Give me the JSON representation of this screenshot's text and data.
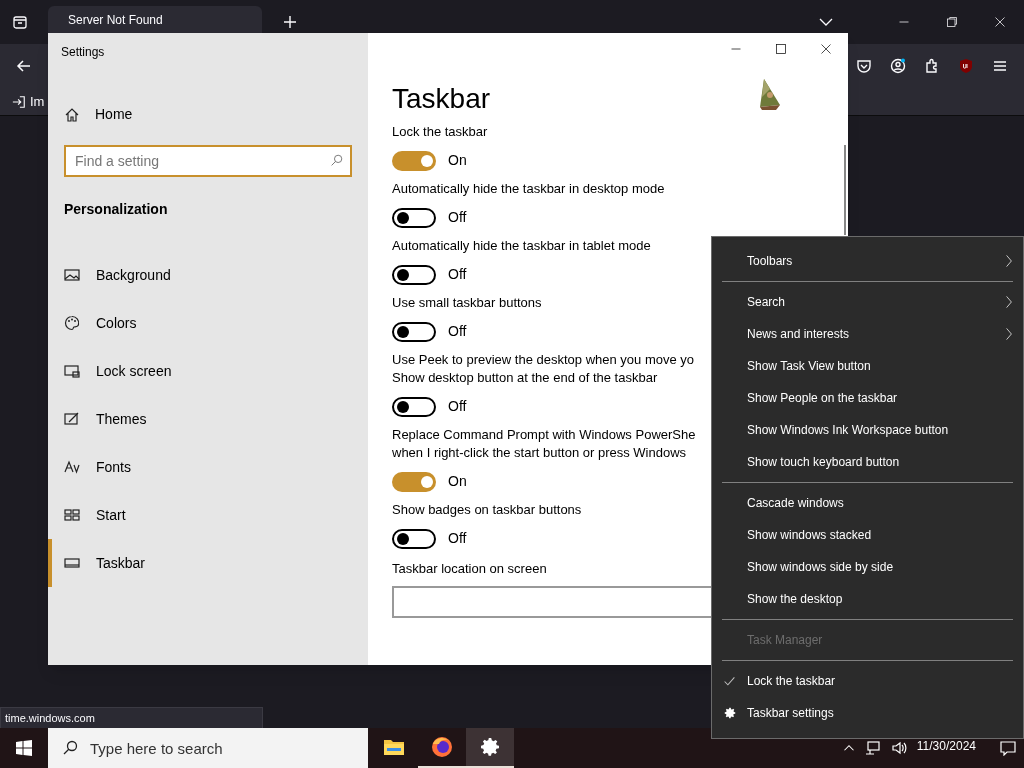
{
  "browser": {
    "tab_title": "Server Not Found",
    "bookmark": "Im",
    "status_url": "time.windows.com"
  },
  "settings": {
    "title": "Settings",
    "home": "Home",
    "search_placeholder": "Find a setting",
    "section": "Personalization",
    "nav": [
      {
        "label": "Background",
        "kind": "background",
        "selected": false
      },
      {
        "label": "Colors",
        "kind": "colors",
        "selected": false
      },
      {
        "label": "Lock screen",
        "kind": "lock",
        "selected": false
      },
      {
        "label": "Themes",
        "kind": "themes",
        "selected": false
      },
      {
        "label": "Fonts",
        "kind": "fonts",
        "selected": false
      },
      {
        "label": "Start",
        "kind": "start",
        "selected": false
      },
      {
        "label": "Taskbar",
        "kind": "taskbar",
        "selected": true
      }
    ],
    "page_title": "Taskbar",
    "toggles": [
      {
        "label": "Lock the taskbar",
        "on": true,
        "state": "On"
      },
      {
        "label": "Automatically hide the taskbar in desktop mode",
        "on": false,
        "state": "Off"
      },
      {
        "label": "Automatically hide the taskbar in tablet mode",
        "on": false,
        "state": "Off"
      },
      {
        "label": "Use small taskbar buttons",
        "on": false,
        "state": "Off"
      },
      {
        "label": "Use Peek to preview the desktop when you move yo\nShow desktop button at the end of the taskbar",
        "on": false,
        "state": "Off"
      },
      {
        "label": "Replace Command Prompt with Windows PowerShe\nwhen I right-click the start button or press Windows",
        "on": true,
        "state": "On"
      },
      {
        "label": "Show badges on taskbar buttons",
        "on": false,
        "state": "Off"
      }
    ],
    "next_heading": "Taskbar location on screen"
  },
  "context_menu": [
    [
      {
        "label": "Toolbars",
        "kind": "submenu",
        "disabled": false,
        "checked": false
      }
    ],
    [
      {
        "label": "Search",
        "kind": "submenu",
        "disabled": false,
        "checked": false
      },
      {
        "label": "News and interests",
        "kind": "submenu",
        "disabled": false,
        "checked": false
      },
      {
        "label": "Show Task View button",
        "kind": "command",
        "disabled": false,
        "checked": false
      },
      {
        "label": "Show People on the taskbar",
        "kind": "command",
        "disabled": false,
        "checked": false
      },
      {
        "label": "Show Windows Ink Workspace button",
        "kind": "command",
        "disabled": false,
        "checked": false
      },
      {
        "label": "Show touch keyboard button",
        "kind": "command",
        "disabled": false,
        "checked": false
      }
    ],
    [
      {
        "label": "Cascade windows",
        "kind": "command",
        "disabled": false,
        "checked": false
      },
      {
        "label": "Show windows stacked",
        "kind": "command",
        "disabled": false,
        "checked": false
      },
      {
        "label": "Show windows side by side",
        "kind": "command",
        "disabled": false,
        "checked": false
      },
      {
        "label": "Show the desktop",
        "kind": "command",
        "disabled": false,
        "checked": false
      }
    ],
    [
      {
        "label": "Task Manager",
        "kind": "command",
        "disabled": true,
        "checked": false
      }
    ],
    [
      {
        "label": "Lock the taskbar",
        "kind": "command",
        "disabled": false,
        "checked": true
      },
      {
        "label": "Taskbar settings",
        "kind": "settings",
        "disabled": false,
        "checked": false
      }
    ]
  ],
  "taskbar": {
    "search_placeholder": "Type here to search",
    "date": "11/30/2024",
    "apps": [
      {
        "kind": "folder",
        "selected": false,
        "running": false
      },
      {
        "kind": "browser",
        "selected": false,
        "running": true
      },
      {
        "kind": "settings",
        "selected": true,
        "running": true
      }
    ]
  }
}
